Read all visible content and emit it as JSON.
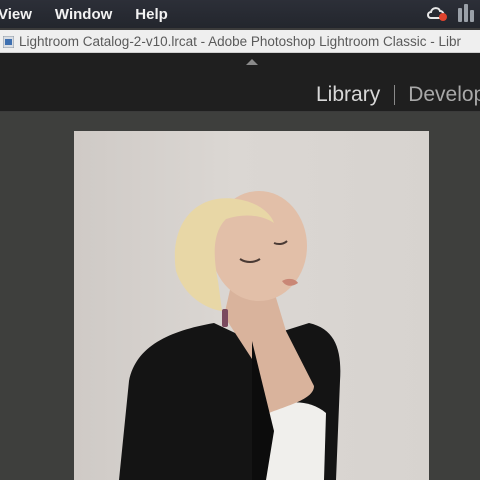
{
  "menubar": {
    "items": [
      "View",
      "Window",
      "Help"
    ]
  },
  "window": {
    "title": "Lightroom Catalog-2-v10.lrcat - Adobe Photoshop Lightroom Classic - Libr"
  },
  "module_picker": {
    "active": "Library",
    "next": "Develop"
  },
  "icons": {
    "creative_cloud": "creative-cloud-icon",
    "status_bars": "status-bars-icon",
    "app": "lightroom-app-icon",
    "collapse": "collapse-arrow-icon"
  },
  "colors": {
    "menubar": "#23262d",
    "titlebar": "#efefef",
    "lr_panel": "#1f1f1f",
    "loupe_bg": "#3e3f3d",
    "photo_bg": "#d7d3cf"
  }
}
